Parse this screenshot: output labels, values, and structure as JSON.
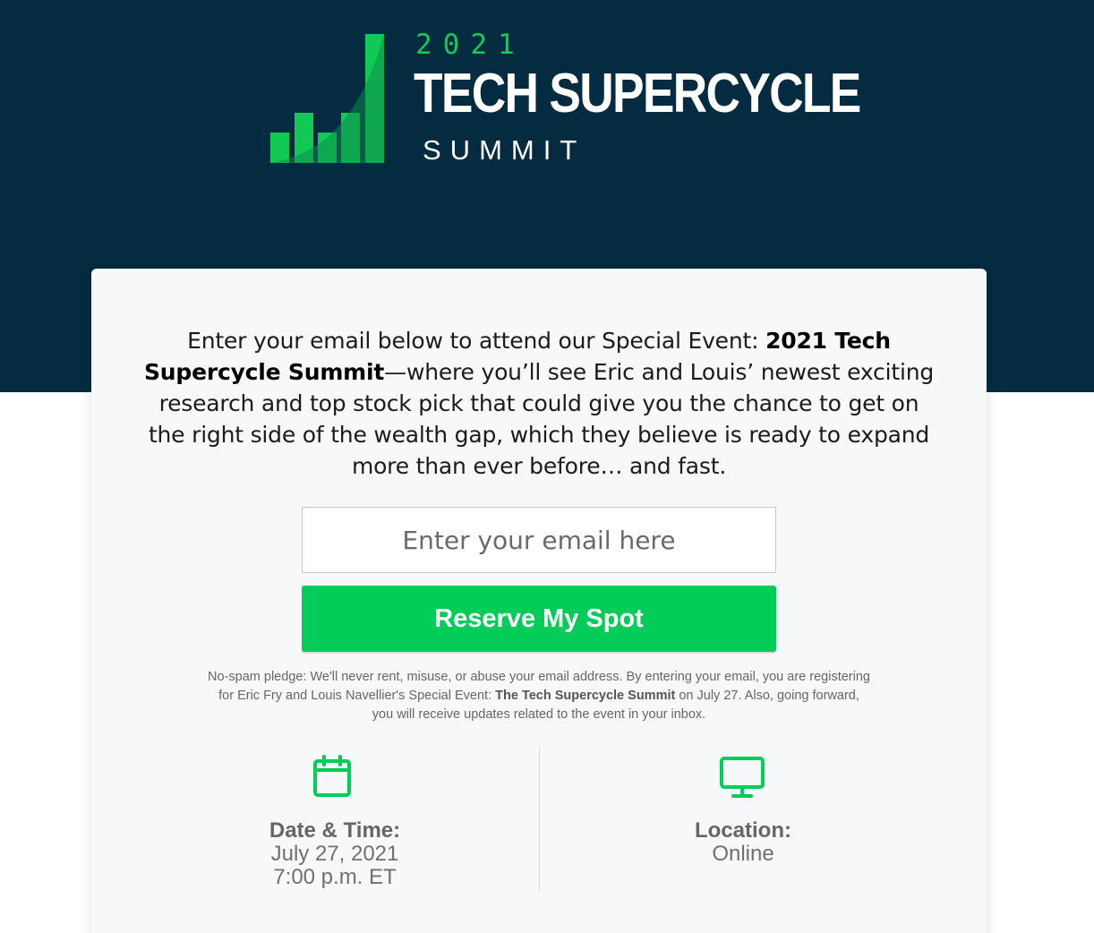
{
  "colors": {
    "header_bg": "#042b3f",
    "accent_green": "#04cc58",
    "logo_green": "#12c956",
    "card_bg": "#f7f8fa"
  },
  "logo": {
    "icon": "bar-chart-growth-icon",
    "year": "2021",
    "title": "TECH SUPERCYCLE",
    "subtitle": "SUMMIT"
  },
  "intro": {
    "lead": "Enter your email below to attend our Special Event: ",
    "event_name": "2021 Tech Supercycle Summit",
    "rest": "—where you’ll see Eric and Louis’ newest exciting research and top stock pick that could give you the chance to get on the right side of the wealth gap, which they believe is ready to expand more than ever before… and fast."
  },
  "form": {
    "email_placeholder": "Enter your email here",
    "email_value": "",
    "submit_label": "Reserve My Spot"
  },
  "pledge": {
    "text_before": "No-spam pledge: We'll never rent, misuse, or abuse your email address. By entering your email, you are registering for Eric Fry and Louis Navellier's Special Event: ",
    "event_name": "The Tech Supercycle Summit",
    "text_after": " on July 27. Also, going forward, you will receive updates related to the event in your inbox."
  },
  "details": {
    "date": {
      "icon": "calendar-icon",
      "label": "Date & Time:",
      "date_value": "July 27, 2021",
      "time_value": "7:00 p.m. ET"
    },
    "location": {
      "icon": "monitor-icon",
      "label": "Location:",
      "value": "Online"
    }
  }
}
